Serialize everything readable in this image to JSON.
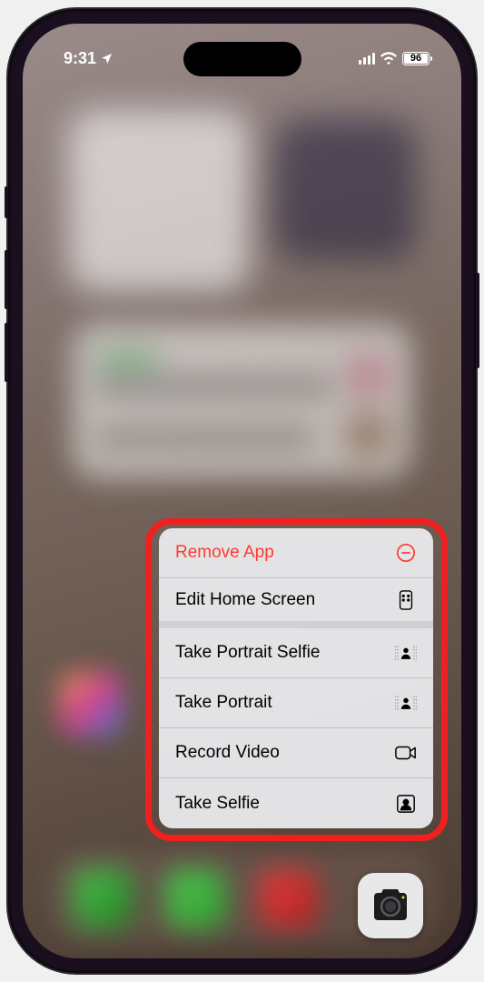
{
  "status_bar": {
    "time": "9:31",
    "battery_percent": "96"
  },
  "context_menu": {
    "items": [
      {
        "label": "Remove App",
        "icon": "remove-circle-icon",
        "destructive": true
      },
      {
        "label": "Edit Home Screen",
        "icon": "apps-grid-icon"
      },
      {
        "label": "Take Portrait Selfie",
        "icon": "portrait-icon"
      },
      {
        "label": "Take Portrait",
        "icon": "portrait-icon"
      },
      {
        "label": "Record Video",
        "icon": "video-icon"
      },
      {
        "label": "Take Selfie",
        "icon": "selfie-icon"
      }
    ]
  },
  "camera_app": {
    "name": "Camera"
  },
  "colors": {
    "destructive": "#ff3b30",
    "highlight": "#ef2020"
  }
}
